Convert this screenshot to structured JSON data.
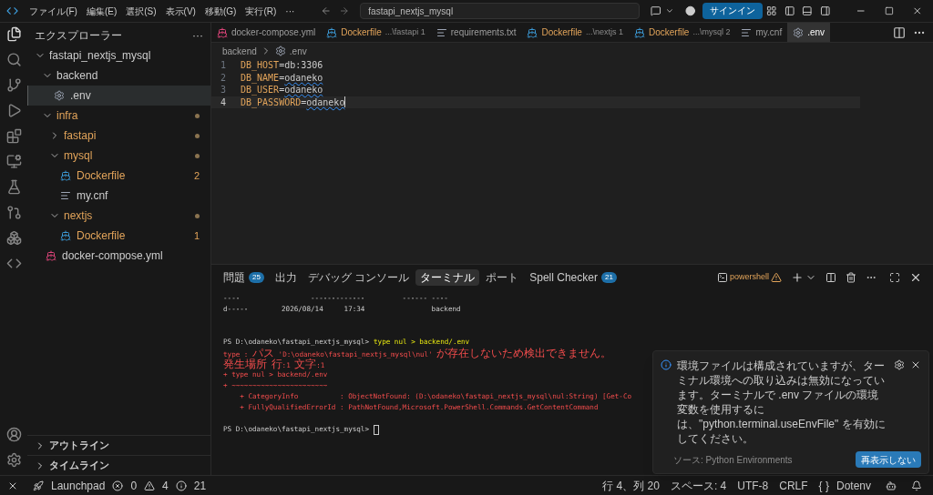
{
  "menu": [
    "ファイル(F)",
    "編集(E)",
    "選択(S)",
    "表示(V)",
    "移動(G)",
    "実行(R)",
    "···"
  ],
  "command_center": {
    "value": "fastapi_nextjs_mysql"
  },
  "sign_in": "サインイン",
  "sidebar": {
    "title": "エクスプローラー",
    "more": "···",
    "tree": [
      {
        "label": "fastapi_nextjs_mysql",
        "kind": "folder",
        "expanded": true,
        "selected": false,
        "decorated": false,
        "children": [
          {
            "label": "backend",
            "kind": "folder",
            "expanded": true,
            "selected": false,
            "decorated": false,
            "children": [
              {
                "label": ".env",
                "kind": "gear",
                "selected": true,
                "decorated": false
              }
            ]
          },
          {
            "label": "infra",
            "kind": "folder",
            "expanded": true,
            "selected": false,
            "decorated": true,
            "dot": true,
            "children": [
              {
                "label": "fastapi",
                "kind": "folder",
                "expanded": false,
                "selected": false,
                "decorated": true,
                "dot": true
              },
              {
                "label": "mysql",
                "kind": "folder",
                "expanded": true,
                "selected": false,
                "decorated": true,
                "dot": true,
                "children": [
                  {
                    "label": "Dockerfile",
                    "kind": "docker",
                    "selected": false,
                    "decorated": true,
                    "badge": "2"
                  },
                  {
                    "label": "my.cnf",
                    "kind": "lines",
                    "selected": false,
                    "decorated": false
                  }
                ]
              },
              {
                "label": "nextjs",
                "kind": "folder",
                "expanded": true,
                "selected": false,
                "decorated": true,
                "dot": true,
                "children": [
                  {
                    "label": "Dockerfile",
                    "kind": "docker",
                    "selected": false,
                    "decorated": true,
                    "badge": "1"
                  }
                ]
              }
            ]
          },
          {
            "label": "docker-compose.yml",
            "kind": "compose",
            "selected": false,
            "decorated": false
          }
        ]
      }
    ]
  },
  "sidebar_sections": [
    {
      "label": "アウトライン",
      "expanded": false
    },
    {
      "label": "タイムライン",
      "expanded": false
    }
  ],
  "tabs": [
    {
      "label": "docker-compose.yml",
      "kind": "compose",
      "decorated": false,
      "selected": false
    },
    {
      "label": "Dockerfile",
      "description": "...\\fastapi 1",
      "kind": "docker",
      "decorated": true,
      "selected": false
    },
    {
      "label": "requirements.txt",
      "kind": "lines",
      "decorated": false,
      "selected": false
    },
    {
      "label": "Dockerfile",
      "description": "...\\nextjs 1",
      "kind": "docker",
      "decorated": true,
      "selected": false
    },
    {
      "label": "Dockerfile",
      "description": "...\\mysql 2",
      "kind": "docker",
      "decorated": true,
      "selected": false
    },
    {
      "label": "my.cnf",
      "kind": "lines",
      "decorated": false,
      "selected": false
    },
    {
      "label": ".env",
      "kind": "gear",
      "decorated": false,
      "selected": true
    }
  ],
  "breadcrumb": [
    "backend",
    ".env"
  ],
  "code": [
    {
      "number": "1",
      "key": "DB_HOST",
      "equals": "=",
      "value": "db:3306",
      "squiggle": false,
      "current": false
    },
    {
      "number": "2",
      "key": "DB_NAME",
      "equals": "=",
      "value": "odaneko",
      "squiggle": true,
      "current": false
    },
    {
      "number": "3",
      "key": "DB_USER",
      "equals": "=",
      "value": "odaneko",
      "squiggle": true,
      "current": false
    },
    {
      "number": "4",
      "key": "DB_PASSWORD",
      "equals": "=",
      "value": "odaneko",
      "squiggle": true,
      "current": true
    }
  ],
  "panel_tabs": [
    {
      "label": "問題",
      "badge": "25",
      "selected": false
    },
    {
      "label": "出力",
      "selected": false
    },
    {
      "label": "デバッグ コンソール",
      "selected": false
    },
    {
      "label": "ターミナル",
      "selected": true
    },
    {
      "label": "ポート",
      "selected": false
    },
    {
      "label": "Spell Checker",
      "badge": "21",
      "selected": false
    }
  ],
  "terminal_name": "powershell",
  "terminal": [
    {
      "kind": "plain",
      "text": "----                 -------------         ------ ----"
    },
    {
      "kind": "plain",
      "text": "d-----        2026/08/14     17:34                backend"
    },
    {
      "kind": "blank"
    },
    {
      "kind": "blank"
    },
    {
      "kind": "prompt",
      "prompt": "PS D:\\odaneko\\fastapi_nextjs_mysql>",
      "command": "type nul > backend/.env"
    },
    {
      "kind": "error",
      "text": "type : パス 'D:\\odaneko\\fastapi_nextjs_mysql\\nul' が存在しないため検出できません。"
    },
    {
      "kind": "error",
      "text": "発生場所 行:1 文字:1"
    },
    {
      "kind": "error",
      "text": "+ type nul > backend/.env"
    },
    {
      "kind": "error",
      "text": "+ ~~~~~~~~~~~~~~~~~~~~~~~"
    },
    {
      "kind": "error",
      "text": "    + CategoryInfo          : ObjectNotFound: (D:\\odaneko\\fastapi_nextjs_mysql\\nul:String) [Get-Co"
    },
    {
      "kind": "error",
      "text": "    + FullyQualifiedErrorId : PathNotFound,Microsoft.PowerShell.Commands.GetContentCommand"
    },
    {
      "kind": "blank"
    },
    {
      "kind": "prompt",
      "prompt": "PS D:\\odaneko\\fastapi_nextjs_mysql>",
      "cursor": true
    }
  ],
  "notification": {
    "message": "環境ファイルは構成されていますが、ターミナル環境への取り込みは無効になっています。ターミナルで .env ファイルの環境変数を使用するには、\"python.terminal.useEnvFile\" を有効にしてください。",
    "source": "ソース: Python Environments",
    "button": "再表示しない"
  },
  "status_bar": {
    "launchpad": "Launchpad",
    "errors": "0",
    "warnings": "4",
    "info": "21",
    "position": "行 4、列 20",
    "spaces": "スペース: 4",
    "encoding": "UTF-8",
    "eol": "CRLF",
    "braces": "{ }",
    "language": "Dotenv"
  }
}
